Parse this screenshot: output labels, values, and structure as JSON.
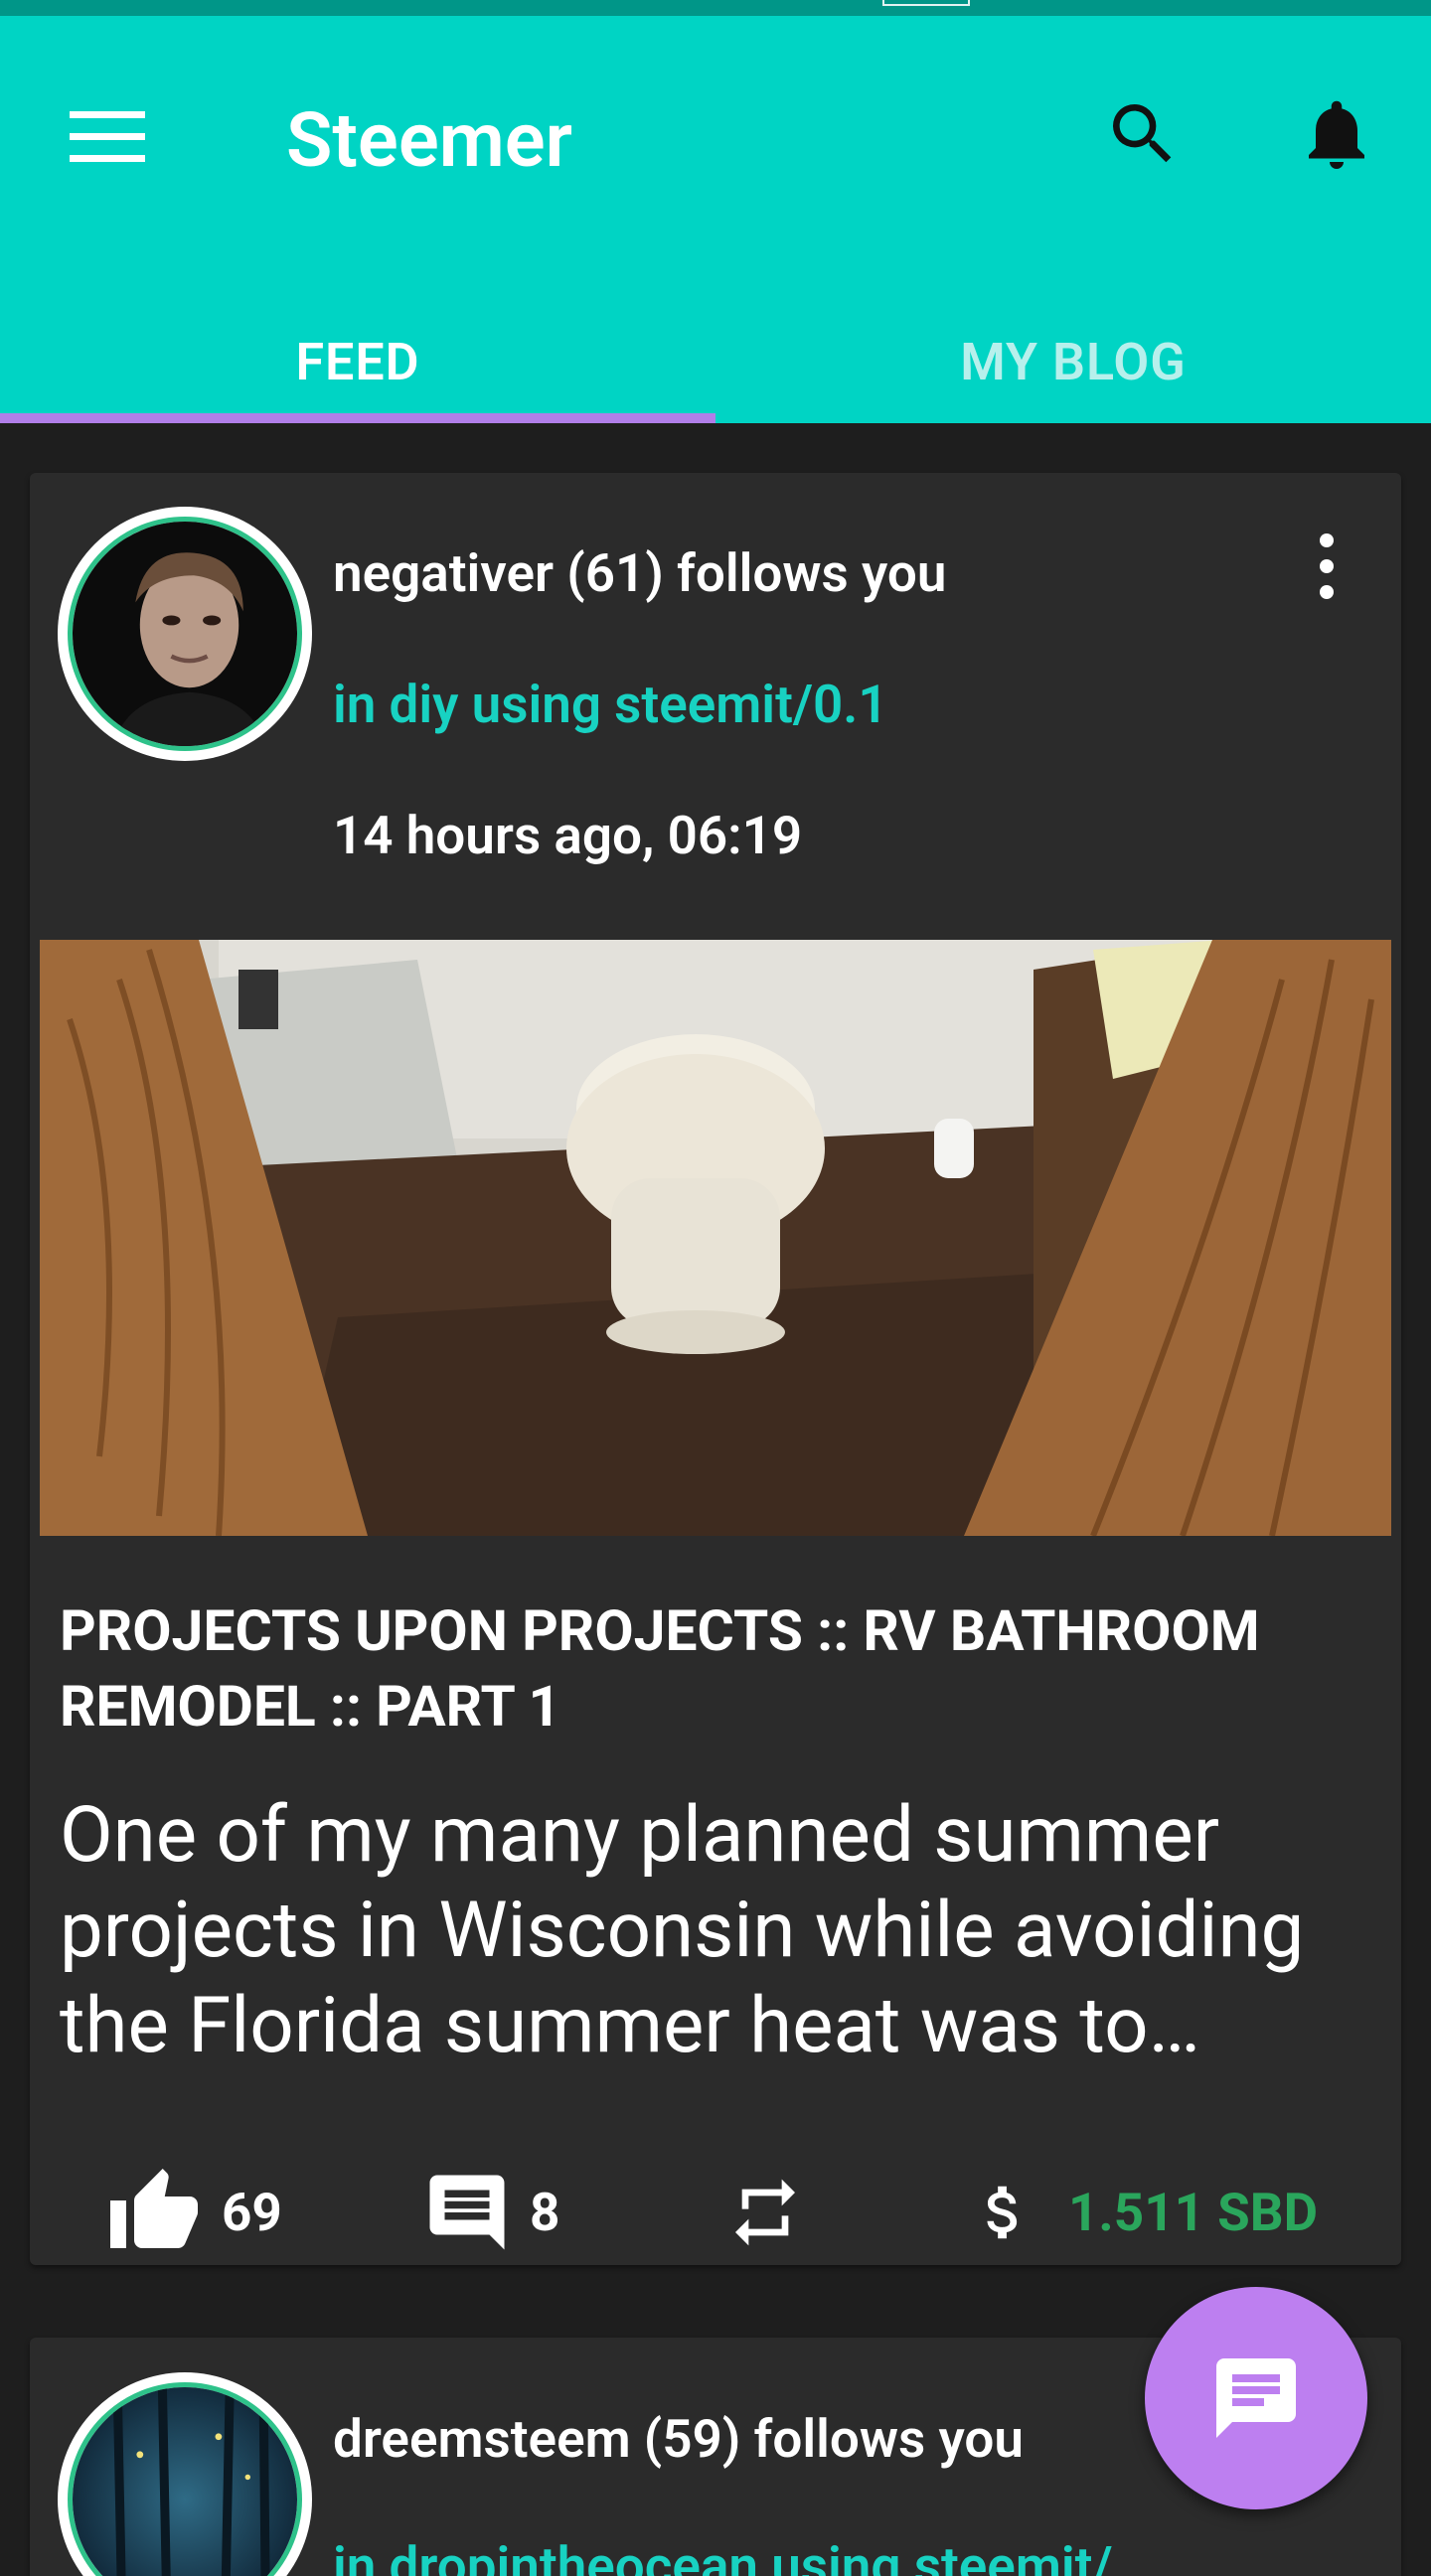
{
  "app": {
    "title": "Steemer",
    "colors": {
      "primary": "#00d4c4",
      "accent": "#b07ee8",
      "card": "#2b2b2b",
      "background": "#1e1e1e",
      "link": "#18d2c2",
      "payout": "#2aa65c"
    }
  },
  "toolbar": {
    "menu_icon": "menu-icon",
    "search_icon": "search-icon",
    "notification_icon": "bell-icon"
  },
  "tabs": [
    {
      "label": "FEED",
      "active": true
    },
    {
      "label": "MY BLOG",
      "active": false
    }
  ],
  "feed": {
    "posts": [
      {
        "author_line": "negativer (61) follows you",
        "category_line": "in diy using steemit/0.1",
        "time": "14 hours ago, 06:19",
        "title": "PROJECTS UPON PROJECTS :: RV BATHROOM REMODEL :: PART 1",
        "excerpt": "One of my many planned summer projects in Wisconsin while avoiding the Florida summer heat was to remodel",
        "votes": "69",
        "comments": "8",
        "payout": "1.511 SBD"
      },
      {
        "author_line": "dreemsteem (59) follows you",
        "category_line": "in dropintheocean using steemit/"
      }
    ]
  },
  "fab": {
    "icon": "chat-icon"
  }
}
